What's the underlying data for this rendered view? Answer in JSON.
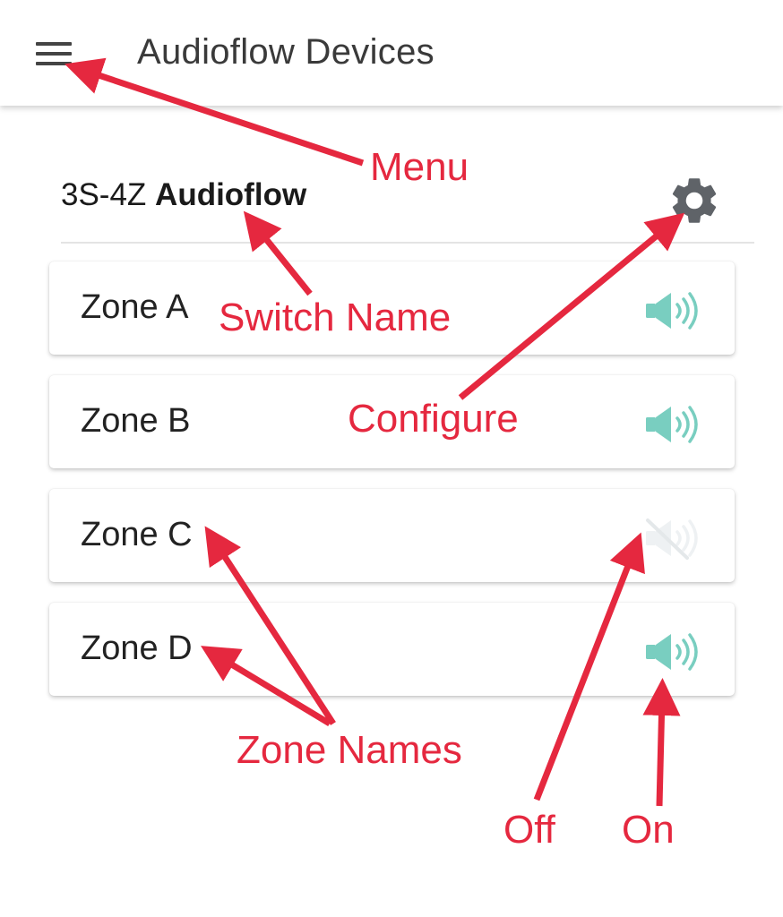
{
  "appbar": {
    "title": "Audioflow Devices",
    "menu_icon": "hamburger-menu-icon"
  },
  "device": {
    "model": "3S-4Z",
    "brand": "Audioflow",
    "settings_icon": "gear-icon"
  },
  "zones": [
    {
      "name": "Zone A",
      "state": "on",
      "icon": "speaker-on-icon"
    },
    {
      "name": "Zone B",
      "state": "on",
      "icon": "speaker-on-icon"
    },
    {
      "name": "Zone C",
      "state": "off",
      "icon": "speaker-off-icon"
    },
    {
      "name": "Zone D",
      "state": "on",
      "icon": "speaker-on-icon"
    }
  ],
  "annotations": {
    "menu": "Menu",
    "switch_name": "Switch Name",
    "configure": "Configure",
    "zone_names": "Zone Names",
    "off": "Off",
    "on": "On"
  },
  "colors": {
    "accent_on": "#79cec0",
    "icon_off": "#eef1f3",
    "gear": "#5f6368",
    "annotation": "#e5283f",
    "title_text": "#3a3a3a"
  }
}
